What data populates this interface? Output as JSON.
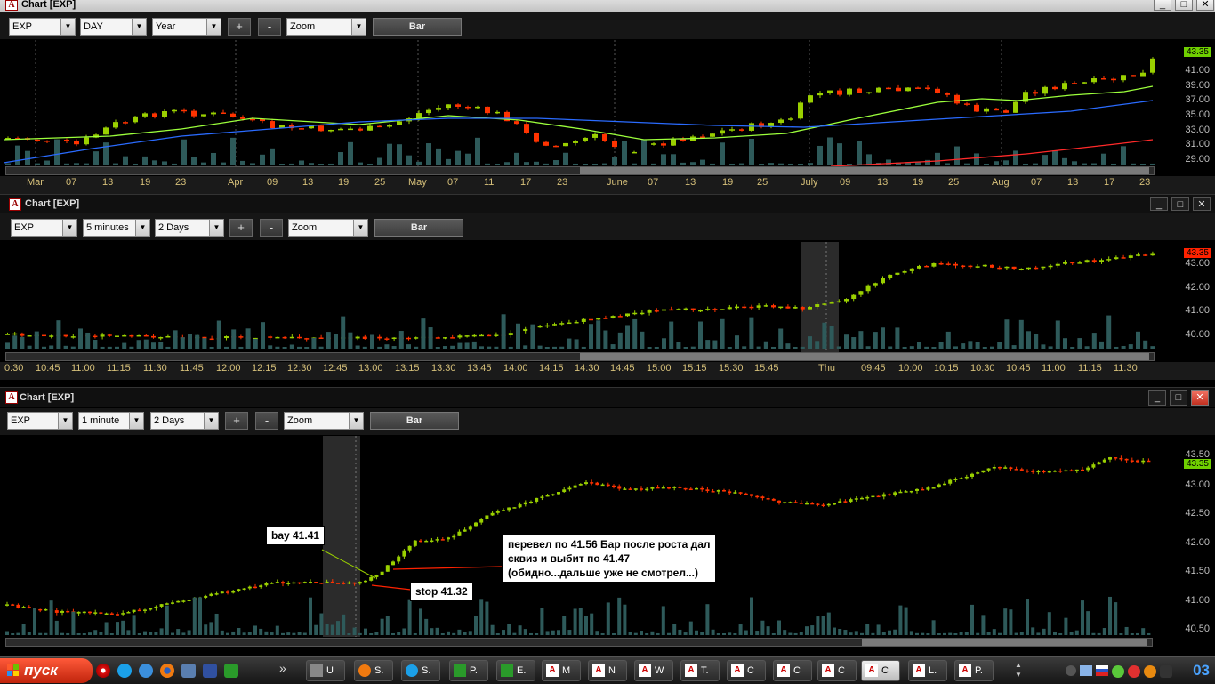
{
  "colors": {
    "up": "#9ad000",
    "down": "#ff3300",
    "volume": "#2e5a5a",
    "ma_fast": "#9cff3c",
    "ma_slow": "#2a6bff",
    "ma_long": "#ff2a2a",
    "axis_text": "#d6c07a",
    "price_text": "#bfbfbf",
    "tag_green": "#6fcf00",
    "tag_red": "#ff2200"
  },
  "windows": [
    {
      "title": "Chart [EXP]",
      "toolbar": {
        "symbol": "EXP",
        "interval": "DAY",
        "period": "Year",
        "plus": "+",
        "minus": "-",
        "zoom": "Zoom",
        "bar": "Bar"
      },
      "price_labels": [
        "41.00",
        "39.00",
        "37.00",
        "35.00",
        "33.00",
        "31.00",
        "29.00"
      ],
      "current_price": "43.35",
      "time_labels": [
        "Mar",
        "07",
        "13",
        "19",
        "23",
        "Apr",
        "09",
        "13",
        "19",
        "25",
        "May",
        "07",
        "11",
        "17",
        "23",
        "June",
        "07",
        "13",
        "19",
        "25",
        "July",
        "09",
        "13",
        "19",
        "25",
        "Aug",
        "07",
        "13",
        "17",
        "23"
      ]
    },
    {
      "title": "Chart [EXP]",
      "toolbar": {
        "symbol": "EXP",
        "interval": "5 minutes",
        "period": "2 Days",
        "plus": "+",
        "minus": "-",
        "zoom": "Zoom",
        "bar": "Bar"
      },
      "price_labels": [
        "43.00",
        "42.00",
        "41.00",
        "40.00"
      ],
      "current_price": "43.35",
      "time_labels": [
        "0:30",
        "10:45",
        "11:00",
        "11:15",
        "11:30",
        "11:45",
        "12:00",
        "12:15",
        "12:30",
        "12:45",
        "13:00",
        "13:15",
        "13:30",
        "13:45",
        "14:00",
        "14:15",
        "14:30",
        "14:45",
        "15:00",
        "15:15",
        "15:30",
        "15:45",
        "Thu",
        "09:45",
        "10:00",
        "10:15",
        "10:30",
        "10:45",
        "11:00",
        "11:15",
        "11:30"
      ]
    },
    {
      "title": "Chart [EXP]",
      "toolbar": {
        "symbol": "EXP",
        "interval": "1 minute",
        "period": "2 Days",
        "plus": "+",
        "minus": "-",
        "zoom": "Zoom",
        "bar": "Bar"
      },
      "price_labels": [
        "43.50",
        "43.00",
        "42.50",
        "42.00",
        "41.50",
        "41.00",
        "40.50"
      ],
      "current_price": "43.35",
      "annotations": {
        "buy": "bay 41.41",
        "stop": "stop 41.32",
        "note": "перевел по 41.56 Бар после роста дал\nсквиз и выбит по 41.47\n(обидно...дальше уже не смотрел...)"
      }
    }
  ],
  "taskbar": {
    "start": "пуск",
    "tasks": [
      {
        "icon": "generic-app-icon",
        "label": "U"
      },
      {
        "icon": "firefox-icon",
        "label": "S."
      },
      {
        "icon": "skype-icon",
        "label": "S."
      },
      {
        "icon": "app-p-icon",
        "label": "P."
      },
      {
        "icon": "app-e-icon",
        "label": "E."
      },
      {
        "icon": "chart-app-icon",
        "label": "M"
      },
      {
        "icon": "chart-app-icon",
        "label": "N"
      },
      {
        "icon": "chart-app-icon",
        "label": "W"
      },
      {
        "icon": "chart-app-icon",
        "label": "T."
      },
      {
        "icon": "chart-app-icon",
        "label": "C"
      },
      {
        "icon": "chart-app-icon",
        "label": "C"
      },
      {
        "icon": "chart-app-icon",
        "label": "C"
      },
      {
        "icon": "chart-app-icon",
        "label": "C"
      },
      {
        "icon": "chart-app-icon",
        "label": "L."
      },
      {
        "icon": "chart-app-icon",
        "label": "P."
      }
    ],
    "clock": "03"
  }
}
